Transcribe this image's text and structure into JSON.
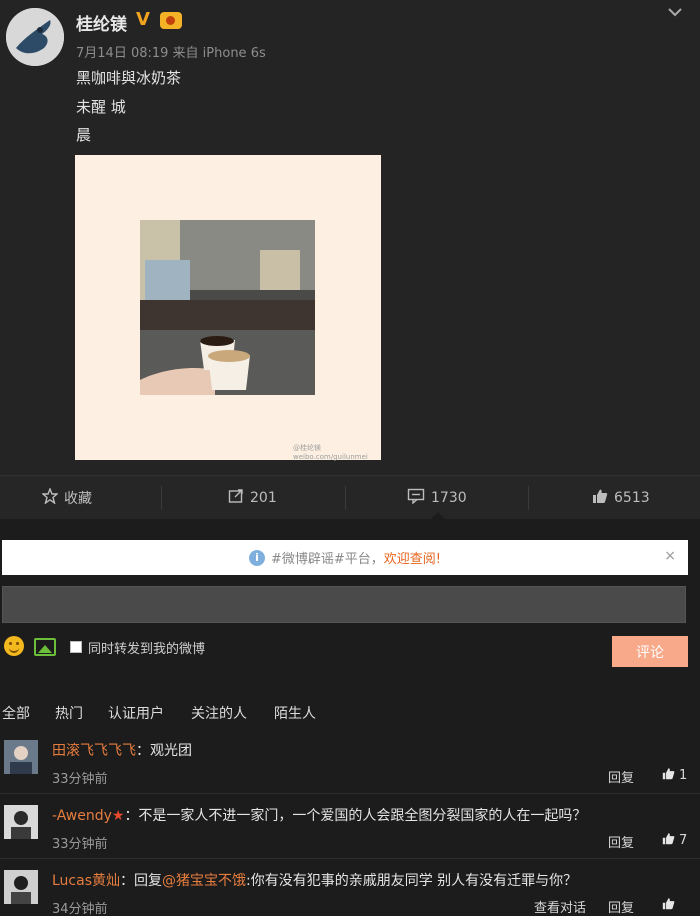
{
  "post": {
    "username": "桂纶镁",
    "verified": "V",
    "meta": "7月14日 08:19 来自 iPhone 6s",
    "lines": [
      "黑咖啡與冰奶茶",
      "未醒 城",
      "晨"
    ],
    "watermark": "@桂纶镁 weibo.com/guilunmei"
  },
  "actions": {
    "favorite": "收藏",
    "repost": "201",
    "comment": "1730",
    "like": "6513"
  },
  "notice": {
    "text": "#微博辟谣#平台，",
    "link": "欢迎查阅!",
    "close": "×"
  },
  "composer": {
    "placeholder": "",
    "repost_label": "同时转发到我的微博",
    "submit": "评论"
  },
  "tabs": [
    "全部",
    "热门",
    "认证用户",
    "关注的人",
    "陌生人"
  ],
  "comments": [
    {
      "name": "田滚飞飞飞飞",
      "text": "：观光团",
      "time": "33分钟前",
      "reply": "回复",
      "likes": "1"
    },
    {
      "name": "-Awendy",
      "badge": "★",
      "text": "：不是一家人不进一家门，一个爱国的人会跟全图分裂国家的人在一起吗？",
      "time": "33分钟前",
      "reply": "回复",
      "likes": "7"
    },
    {
      "name": "Lucas黄灿",
      "prefix": "：回复",
      "mention": "@猪宝宝不饿",
      "text": ":你有没有犯事的亲戚朋友同学 别人有没有迁罪与你？",
      "time": "34分钟前",
      "view": "查看对话",
      "reply": "回复",
      "likes": ""
    }
  ],
  "colors": {
    "accent": "#e8651f",
    "username_orange": "#e67d3e",
    "submit_bg": "#f7a98a",
    "background": "#1c1c1c"
  }
}
